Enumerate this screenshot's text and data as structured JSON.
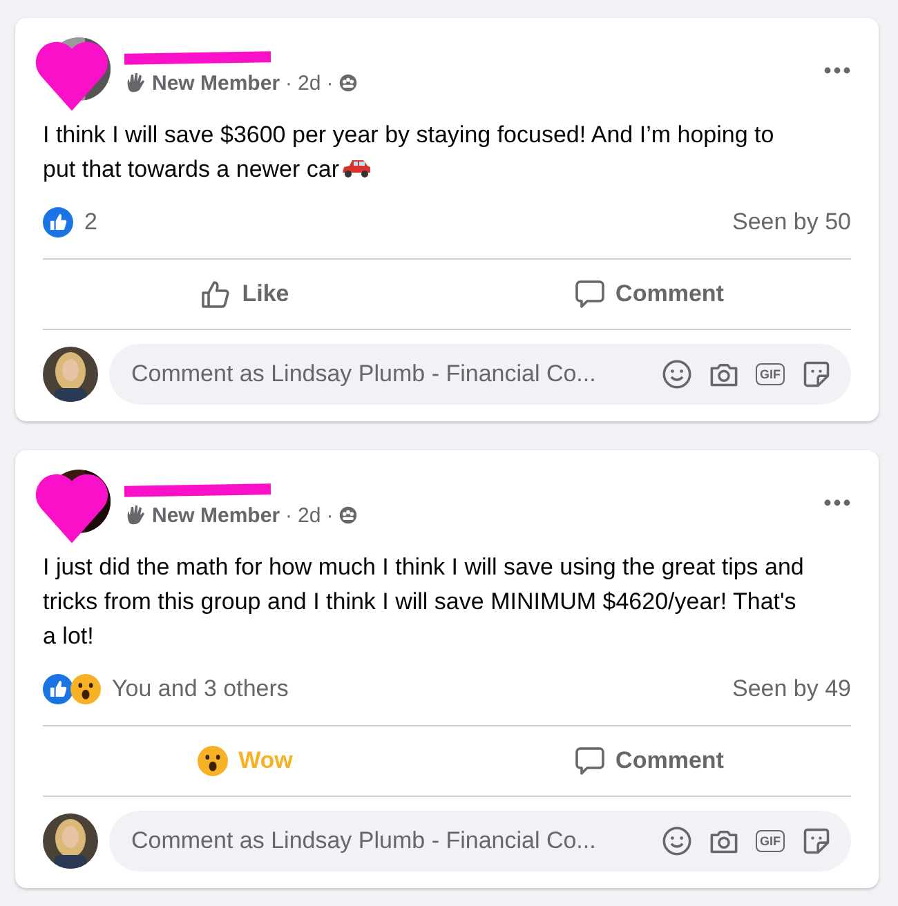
{
  "posts": [
    {
      "author_redacted": true,
      "badge": "New Member",
      "separator": "·",
      "time": "2d",
      "body": "I think I will save $3600 per year by staying focused! And I’m hoping to put that towards a newer car",
      "body_emoji": {
        "kind": "car"
      },
      "reactions": [
        {
          "kind": "like"
        }
      ],
      "reaction_text": "2",
      "seen": "Seen by 50",
      "actions": [
        {
          "kind": "like",
          "label": "Like"
        },
        {
          "kind": "comment",
          "label": "Comment"
        }
      ],
      "composer": {
        "placeholder": "Comment as Lindsay Plumb - Financial Co...",
        "gif_label": "GIF"
      }
    },
    {
      "author_redacted": true,
      "badge": "New Member",
      "separator": "·",
      "time": "2d",
      "body": "I just did the math for how much I think I will save using the great tips and tricks from this group and I think I will save MINIMUM $4620/year! That's a lot!",
      "reactions": [
        {
          "kind": "like"
        },
        {
          "kind": "wow"
        }
      ],
      "reaction_text": "You and 3 others",
      "seen": "Seen by 49",
      "actions": [
        {
          "kind": "wow",
          "label": "Wow"
        },
        {
          "kind": "comment",
          "label": "Comment"
        }
      ],
      "composer": {
        "placeholder": "Comment as Lindsay Plumb - Financial Co...",
        "gif_label": "GIF"
      }
    }
  ]
}
